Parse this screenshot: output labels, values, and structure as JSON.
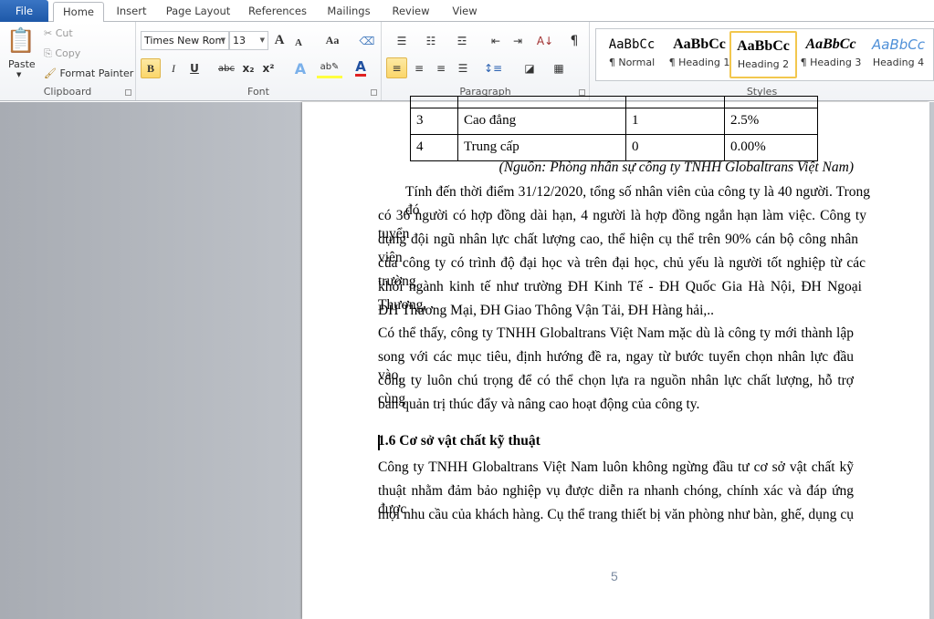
{
  "tabs": [
    "File",
    "Home",
    "Insert",
    "Page Layout",
    "References",
    "Mailings",
    "Review",
    "View"
  ],
  "clipboard": {
    "paste": "Paste",
    "cut": "Cut",
    "copy": "Copy",
    "format_painter": "Format Painter",
    "label": "Clipboard"
  },
  "font": {
    "name": "Times New Rom",
    "size": "13",
    "label": "Font",
    "bold": "B",
    "italic": "I",
    "underline": "U",
    "strike": "abc",
    "sub": "x₂",
    "sup": "x²",
    "grow": "A",
    "shrink": "A",
    "case": "Aa",
    "font_color": "#e02020"
  },
  "paragraph": {
    "label": "Paragraph",
    "pilcrow": "¶"
  },
  "styles": {
    "label": "Styles",
    "items": [
      {
        "preview": "AaBbCc",
        "name": "¶ Normal"
      },
      {
        "preview": "AaBbCc",
        "name": "¶ Heading 1"
      },
      {
        "preview": "AaBbCc",
        "name": "Heading 2",
        "selected": true
      },
      {
        "preview": "AaBbCc",
        "name": "¶ Heading 3"
      },
      {
        "preview": "AaBbCc",
        "name": "Heading 4"
      }
    ]
  },
  "document": {
    "table": [
      [
        "",
        "",
        "",
        ""
      ],
      [
        "3",
        "Cao đẳng",
        "1",
        "2.5%"
      ],
      [
        "4",
        "Trung cấp",
        "0",
        "0.00%"
      ]
    ],
    "source": "(Nguồn: Phòng nhân sự công ty TNHH Globaltrans Việt Nam)",
    "para1": [
      "Tính đến thời điểm 31/12/2020, tổng số nhân viên của công ty là 40 người. Trong đó",
      "có 36 người có hợp đồng dài hạn, 4 người là hợp đồng ngắn hạn làm việc. Công ty tuyển",
      "dụng đội ngũ nhân lực chất lượng cao, thể hiện cụ thể trên  90% cán bộ công nhân viên",
      "của công ty có trình độ đại học và trên đại học, chủ yếu là người tốt nghiệp từ các trường",
      "khối ngành kinh tế như trường ĐH Kinh Tế - ĐH Quốc Gia Hà Nội, ĐH Ngoại Thương,",
      "ĐH Thương Mại, ĐH Giao Thông Vận Tải, ĐH Hàng hải,.."
    ],
    "para2": [
      "Có thể thấy, công ty TNHH Globaltrans Việt Nam mặc dù là công ty mới thành lập",
      "song với các mục tiêu, định hướng đề ra, ngay từ bước tuyển chọn nhân lực đầu vào,",
      "công ty luôn chú trọng để có thể chọn lựa ra nguồn nhân lực chất lượng, hỗ trợ cùng",
      "ban quản trị thúc đẩy và nâng cao hoạt động của công ty."
    ],
    "heading": "1.6 Cơ sở vật chất kỹ thuật",
    "para3": [
      "Công ty TNHH Globaltrans Việt Nam luôn không ngừng đầu tư cơ sở vật chất kỹ",
      "thuật nhằm đảm bảo nghiệp vụ được diễn ra nhanh chóng, chính xác và đáp ứng được",
      "mọi nhu cầu của khách hàng. Cụ thể trang thiết bị văn phòng như bàn, ghế, dụng cụ"
    ],
    "page_number": "5"
  }
}
